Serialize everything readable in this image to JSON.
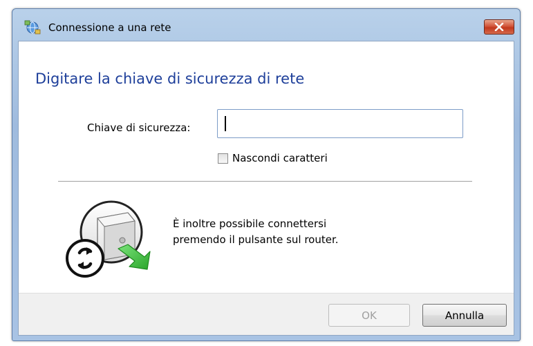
{
  "window": {
    "title": "Connessione a una rete"
  },
  "main": {
    "heading": "Digitare la chiave di sicurezza di rete",
    "key_label": "Chiave di sicurezza:",
    "key_value": "",
    "hide_chars_label": "Nascondi caratteri",
    "hide_chars_checked": false,
    "router_text_line1": "È inoltre possibile connettersi",
    "router_text_line2": "premendo il pulsante sul router."
  },
  "buttons": {
    "ok_label": "OK",
    "ok_enabled": false,
    "cancel_label": "Annulla"
  },
  "icons": {
    "title": "network-icon",
    "close": "close-icon",
    "illustration": "router-button-icon"
  },
  "colors": {
    "heading": "#1e3f9a",
    "close_button": "#c2381c",
    "arrow": "#3cbf3c"
  }
}
